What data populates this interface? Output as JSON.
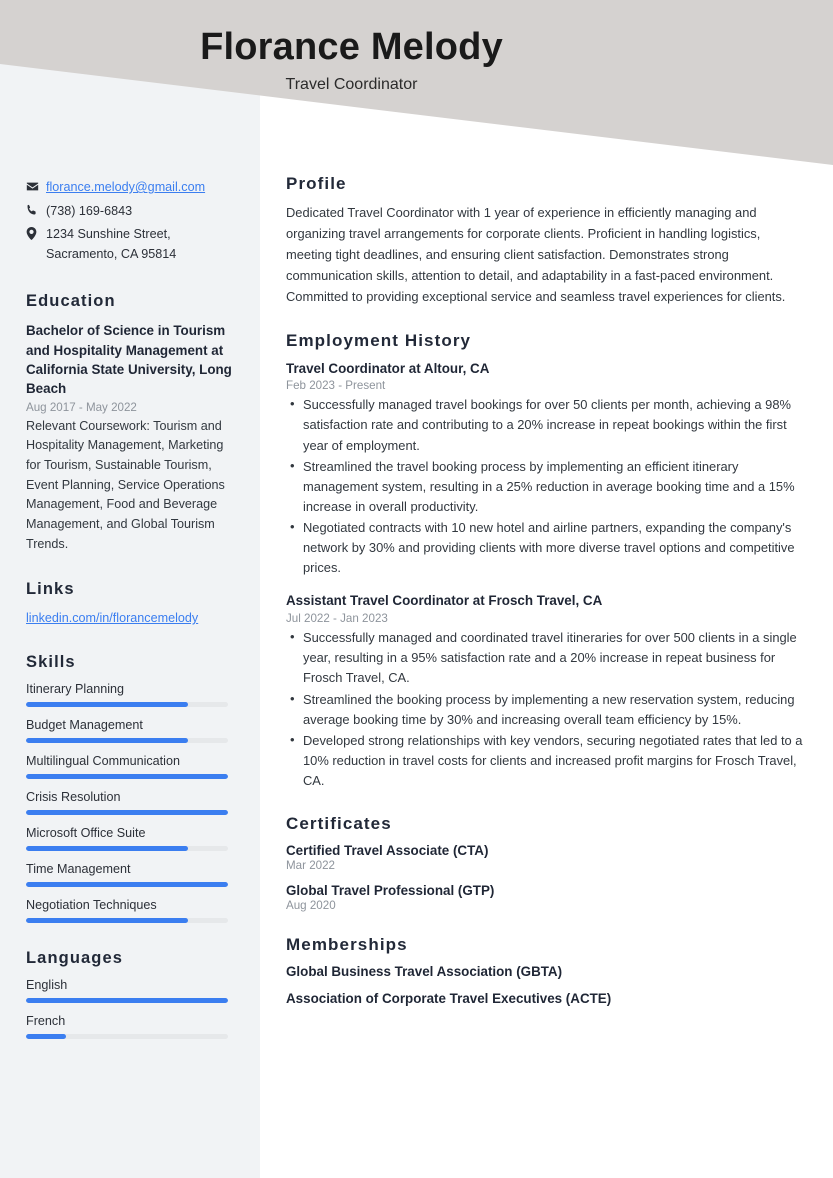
{
  "theme": {
    "accent": "#3b7ef0",
    "header_bg": "#d5d2d0",
    "sidebar_bg": "#f1f3f5",
    "heading_color": "#222938",
    "muted_color": "#8e949c"
  },
  "header": {
    "name": "Florance Melody",
    "job_title": "Travel Coordinator"
  },
  "sidebar": {
    "contact": [
      {
        "icon": "envelope-icon",
        "text": "florance.melody@gmail.com",
        "is_link": true
      },
      {
        "icon": "phone-icon",
        "text": "(738) 169-6843",
        "is_link": false
      },
      {
        "icon": "location-pin-icon",
        "text": "1234 Sunshine Street, Sacramento, CA 95814",
        "is_link": false
      }
    ],
    "education": {
      "heading": "Education",
      "entries": [
        {
          "degree": "Bachelor of Science in Tourism and Hospitality Management at California State University, Long Beach",
          "dates": "Aug 2017 - May 2022",
          "description": "Relevant Coursework: Tourism and Hospitality Management, Marketing for Tourism, Sustainable Tourism, Event Planning, Service Operations Management, Food and Beverage Management, and Global Tourism Trends."
        }
      ]
    },
    "links": {
      "heading": "Links",
      "items": [
        {
          "label": "linkedin.com/in/florancemelody"
        }
      ]
    },
    "skills": {
      "heading": "Skills",
      "items": [
        {
          "label": "Itinerary Planning",
          "level": 80
        },
        {
          "label": "Budget Management",
          "level": 80
        },
        {
          "label": "Multilingual Communication",
          "level": 100
        },
        {
          "label": "Crisis Resolution",
          "level": 100
        },
        {
          "label": "Microsoft Office Suite",
          "level": 80
        },
        {
          "label": "Time Management",
          "level": 100
        },
        {
          "label": "Negotiation Techniques",
          "level": 80
        }
      ]
    },
    "languages": {
      "heading": "Languages",
      "items": [
        {
          "label": "English",
          "level": 100
        },
        {
          "label": "French",
          "level": 20
        }
      ]
    }
  },
  "main": {
    "profile": {
      "heading": "Profile",
      "text": "Dedicated Travel Coordinator with 1 year of experience in efficiently managing and organizing travel arrangements for corporate clients. Proficient in handling logistics, meeting tight deadlines, and ensuring client satisfaction. Demonstrates strong communication skills, attention to detail, and adaptability in a fast-paced environment. Committed to providing exceptional service and seamless travel experiences for clients."
    },
    "employment": {
      "heading": "Employment History",
      "entries": [
        {
          "title": "Travel Coordinator at Altour, CA",
          "dates": "Feb 2023 - Present",
          "bullets": [
            "Successfully managed travel bookings for over 50 clients per month, achieving a 98% satisfaction rate and contributing to a 20% increase in repeat bookings within the first year of employment.",
            "Streamlined the travel booking process by implementing an efficient itinerary management system, resulting in a 25% reduction in average booking time and a 15% increase in overall productivity.",
            "Negotiated contracts with 10 new hotel and airline partners, expanding the company's network by 30% and providing clients with more diverse travel options and competitive prices."
          ]
        },
        {
          "title": "Assistant Travel Coordinator at Frosch Travel, CA",
          "dates": "Jul 2022 - Jan 2023",
          "bullets": [
            "Successfully managed and coordinated travel itineraries for over 500 clients in a single year, resulting in a 95% satisfaction rate and a 20% increase in repeat business for Frosch Travel, CA.",
            "Streamlined the booking process by implementing a new reservation system, reducing average booking time by 30% and increasing overall team efficiency by 15%.",
            "Developed strong relationships with key vendors, securing negotiated rates that led to a 10% reduction in travel costs for clients and increased profit margins for Frosch Travel, CA."
          ]
        }
      ]
    },
    "certificates": {
      "heading": "Certificates",
      "entries": [
        {
          "name": "Certified Travel Associate (CTA)",
          "date": "Mar 2022"
        },
        {
          "name": "Global Travel Professional (GTP)",
          "date": "Aug 2020"
        }
      ]
    },
    "memberships": {
      "heading": "Memberships",
      "entries": [
        {
          "name": "Global Business Travel Association (GBTA)"
        },
        {
          "name": "Association of Corporate Travel Executives (ACTE)"
        }
      ]
    }
  }
}
